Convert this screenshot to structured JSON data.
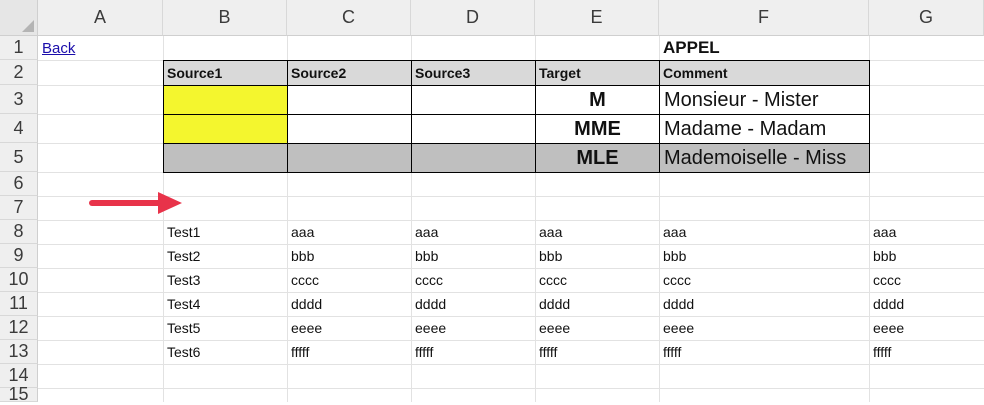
{
  "columns": [
    "A",
    "B",
    "C",
    "D",
    "E",
    "F",
    "G"
  ],
  "rows": [
    "1",
    "2",
    "3",
    "4",
    "5",
    "6",
    "7",
    "8",
    "9",
    "10",
    "11",
    "12",
    "13",
    "14",
    "15"
  ],
  "back_link": "Back",
  "title": "APPEL",
  "mapping_table": {
    "headers": [
      "Source1",
      "Source2",
      "Source3",
      "Target",
      "Comment"
    ],
    "rows": [
      {
        "target": "M",
        "comment": "Monsieur - Mister",
        "fill": "yellow"
      },
      {
        "target": "MME",
        "comment": "Madame - Madam",
        "fill": "yellow"
      },
      {
        "target": "MLE",
        "comment": "Mademoiselle - Miss",
        "fill": "grey"
      }
    ]
  },
  "arrow_color": "#e8334a",
  "test_rows": [
    {
      "label": "Test1",
      "value": "aaa"
    },
    {
      "label": "Test2",
      "value": "bbb"
    },
    {
      "label": "Test3",
      "value": "cccc"
    },
    {
      "label": "Test4",
      "value": "dddd"
    },
    {
      "label": "Test5",
      "value": "eeee"
    },
    {
      "label": "Test6",
      "value": "fffff"
    }
  ]
}
